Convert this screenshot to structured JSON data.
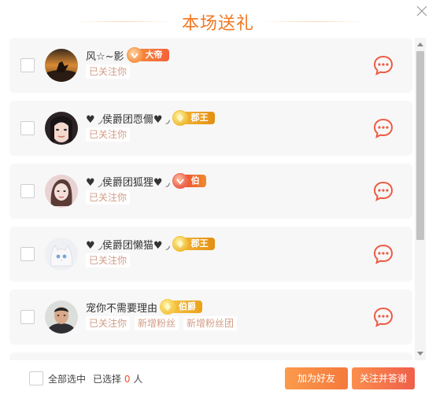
{
  "dialog": {
    "title": "本场送礼"
  },
  "gifters": [
    {
      "name": "风☆~影",
      "badge": "大帝",
      "badge_type": "emperor",
      "tags": [
        "已关注你"
      ]
    },
    {
      "name": "♥ ◞侯爵团恧儞♥ ◞",
      "badge": "郡王",
      "badge_type": "king",
      "tags": [
        "已关注你"
      ]
    },
    {
      "name": "♥ ◞侯爵团狐狸♥ ◞",
      "badge": "伯",
      "badge_type": "prince",
      "tags": [
        "已关注你"
      ]
    },
    {
      "name": "♥ ◞侯爵团懒猫♥ ◞",
      "badge": "郡王",
      "badge_type": "king",
      "tags": [
        "已关注你"
      ]
    },
    {
      "name": "宠你不需要理由",
      "badge": "伯爵",
      "badge_type": "earl",
      "tags": [
        "已关注你",
        "新增粉丝",
        "新增粉丝团"
      ]
    }
  ],
  "footer": {
    "select_all_label": "全部选中",
    "selected_prefix": "已选择",
    "selected_count": "0",
    "selected_suffix": "人",
    "add_friend_label": "加为好友",
    "follow_thank_label": "关注并答谢"
  },
  "colors": {
    "accent": "#f07824",
    "tag_text": "#d39c87",
    "chat_icon": "#ee5b45"
  },
  "icons": {
    "close": "close-icon",
    "chat": "chat-bubble-icon",
    "scroll_up": "triangle-up-icon",
    "scroll_down": "triangle-down-icon"
  }
}
